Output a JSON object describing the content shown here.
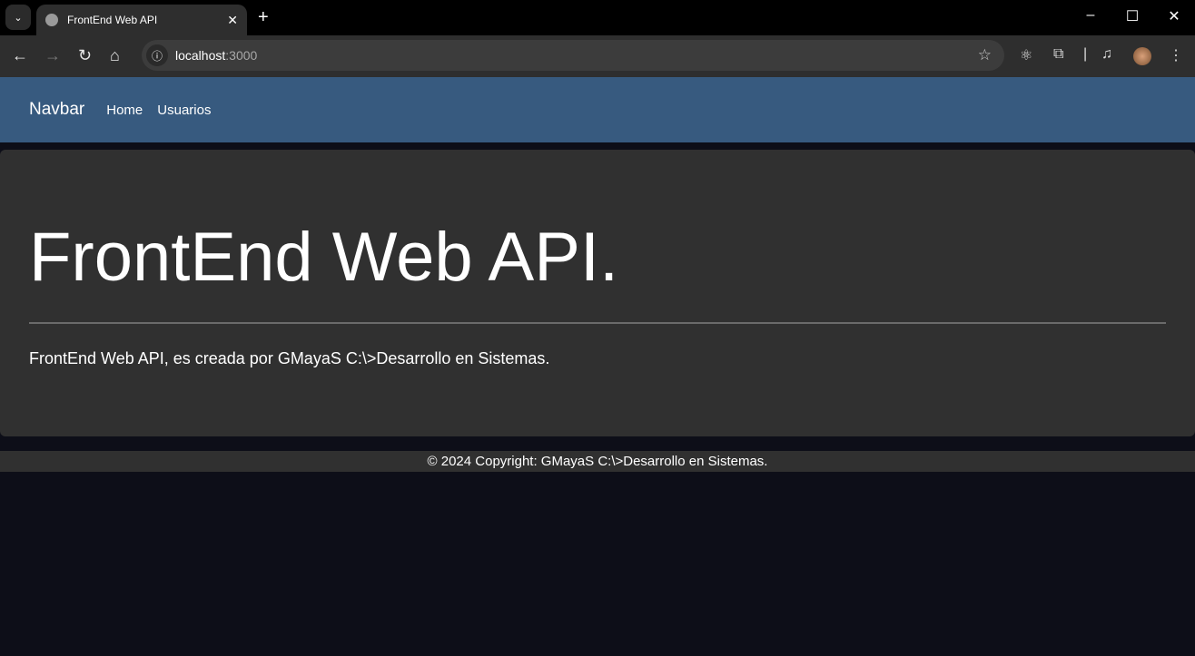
{
  "browser": {
    "tab_title": "FrontEnd Web API",
    "url_host": "localhost",
    "url_port": ":3000"
  },
  "navbar": {
    "brand": "Navbar",
    "links": [
      "Home",
      "Usuarios"
    ]
  },
  "jumbotron": {
    "title": "FrontEnd Web API.",
    "lead": "FrontEnd Web API, es creada por GMayaS C:\\>Desarrollo en Sistemas."
  },
  "footer": {
    "text": "© 2024 Copyright: GMayaS C:\\>Desarrollo en Sistemas."
  },
  "colors": {
    "navbar": "#375a7f",
    "card": "#303030",
    "page": "#0d0e18"
  }
}
